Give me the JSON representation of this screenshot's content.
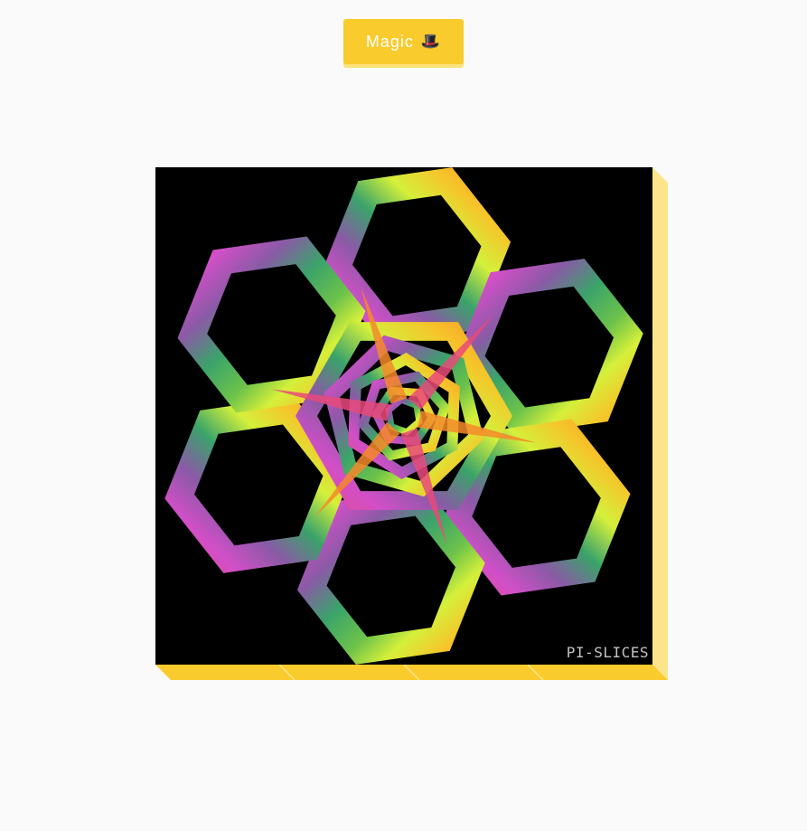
{
  "header": {
    "magic_button": {
      "label": "Magic",
      "icon": "top-hat-icon",
      "glyph": "🎩"
    }
  },
  "artwork": {
    "watermark": "PI-SLICES",
    "background": "#000000",
    "palette": [
      "#e84a7a",
      "#d24fc8",
      "#8a5aa6",
      "#3aa36a",
      "#6cc24a",
      "#d4f03a",
      "#f6c42a",
      "#f58a2a"
    ]
  },
  "frame": {
    "accent": "#f9cb2c",
    "side_accent": "#fbe48a"
  }
}
